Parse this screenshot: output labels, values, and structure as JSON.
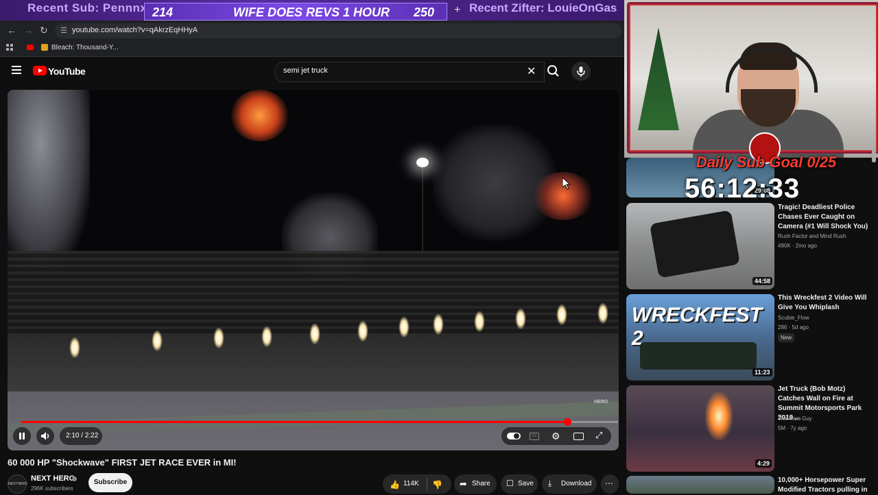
{
  "overlay": {
    "recent_sub": "Recent Sub: Pennnx",
    "count_left": "214",
    "goal_text": "WIFE DOES REVS 1 HOUR",
    "count_right": "250",
    "recent_zifter": "Recent Zifter: LouieOnGas"
  },
  "browser": {
    "url": "youtube.com/watch?v=qAkrzEqHHyA",
    "bookmark_label": "Bleach: Thousand-Y..."
  },
  "youtube": {
    "brand": "YouTube",
    "search_query": "semi jet truck"
  },
  "player": {
    "time_display": "2:10 / 2:22",
    "progress": 0.915,
    "watermark": "HERO"
  },
  "video": {
    "title": "60 000 HP \"Shockwave\" FIRST JET RACE EVER in MI!",
    "channel_name": "NEXT HERO",
    "channel_avatar_text": "NEXTHERO",
    "subscribers": "296K subscribers",
    "subscribe_label": "Subscribe",
    "like_count": "114K",
    "share_label": "Share",
    "save_label": "Save",
    "download_label": "Download"
  },
  "stream": {
    "goal_label": "Daily Sub Goal 0/25",
    "countdown": "56:12:33"
  },
  "recommendations": [
    {
      "title": "Tragic! Deadliest Police Chases Ever Caught on Camera (#1 Will Shock You)",
      "channel": "Rush Factor and Mind Rush",
      "meta": "490K · 2mo ago",
      "duration": "44:58",
      "badge": ""
    },
    {
      "title": "This Wreckfest 2 Video Will Give You Whiplash",
      "channel": "Scubie_Flow",
      "meta": "286 · 5d ago",
      "duration": "11:23",
      "badge": "New",
      "thumb_text": "WRECKFEST 2"
    },
    {
      "title": "Jet Truck (Bob Motz) Catches Wall on Fire at Summit Motorsports Park 2019 ...",
      "channel": "The Ram Guy",
      "meta": "5M · 7y ago",
      "duration": "4:29",
      "badge": ""
    },
    {
      "title": "10,000+ Horsepower Super Modified Tractors pulling in",
      "channel": "",
      "meta": "",
      "duration": "",
      "badge": ""
    }
  ],
  "partial_duration": "29:08"
}
